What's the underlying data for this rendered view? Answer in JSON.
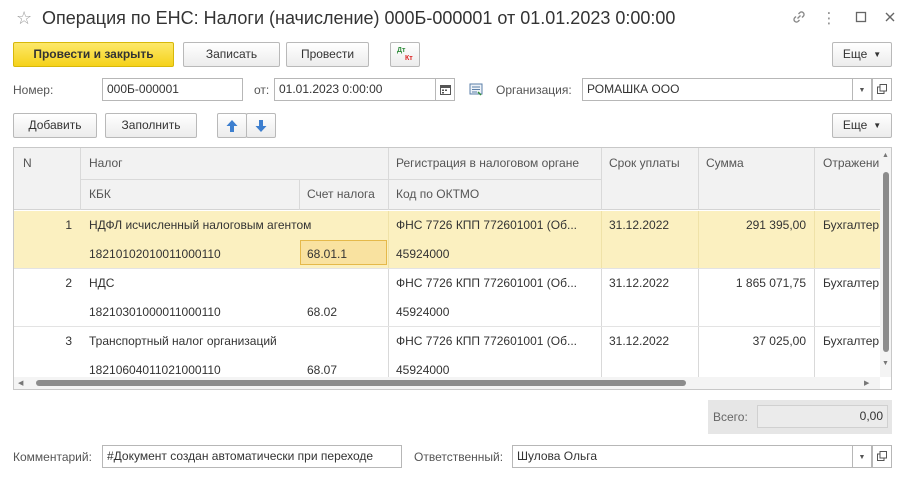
{
  "window": {
    "title": "Операция по ЕНС: Налоги (начисление) 000Б-000001 от 01.01.2023 0:00:00"
  },
  "toolbar": {
    "post_close": "Провести и закрыть",
    "save": "Записать",
    "post": "Провести",
    "dtkt_top": "Дт",
    "dtkt_bottom": "Кт",
    "more": "Еще"
  },
  "header": {
    "number_label": "Номер:",
    "number_value": "000Б-000001",
    "from_label": "от:",
    "date_value": "01.01.2023  0:00:00",
    "org_label": "Организация:",
    "org_value": "РОМАШКА ООО"
  },
  "table_toolbar": {
    "add": "Добавить",
    "fill": "Заполнить",
    "more": "Еще"
  },
  "table": {
    "headers": {
      "n": "N",
      "tax": "Налог",
      "kbk": "КБК",
      "account": "Счет налога",
      "registration": "Регистрация в налоговом органе",
      "oktmo": "Код по ОКТМО",
      "due": "Срок уплаты",
      "amount": "Сумма",
      "reflection": "Отражение"
    },
    "rows": [
      {
        "n": "1",
        "tax": "НДФЛ исчисленный налоговым агентом",
        "kbk": "18210102010011000110",
        "account": "68.01.1",
        "registration": "ФНС 7726 КПП 772601001 (Об...",
        "oktmo": "45924000",
        "due": "31.12.2022",
        "amount": "291 395,00",
        "reflection": "Бухгалтерский"
      },
      {
        "n": "2",
        "tax": "НДС",
        "kbk": "18210301000011000110",
        "account": "68.02",
        "registration": "ФНС 7726 КПП 772601001 (Об...",
        "oktmo": "45924000",
        "due": "31.12.2022",
        "amount": "1 865 071,75",
        "reflection": "Бухгалтерский"
      },
      {
        "n": "3",
        "tax": "Транспортный налог организаций",
        "kbk": "18210604011021000110",
        "account": "68.07",
        "registration": "ФНС 7726 КПП 772601001 (Об...",
        "oktmo": "45924000",
        "due": "31.12.2022",
        "amount": "37 025,00",
        "reflection": "Бухгалтерский"
      }
    ]
  },
  "totals": {
    "label": "Всего:",
    "value": "0,00"
  },
  "footer": {
    "comment_label": "Комментарий:",
    "comment_value": "#Документ создан автоматически при переходе",
    "responsible_label": "Ответственный:",
    "responsible_value": "Шулова Ольга"
  },
  "colors": {
    "primary_button": "#f5d21a",
    "selected_row": "#fbf0c0",
    "focused_cell": "#f9e2a0",
    "arrow_blue": "#3d7fcf"
  }
}
